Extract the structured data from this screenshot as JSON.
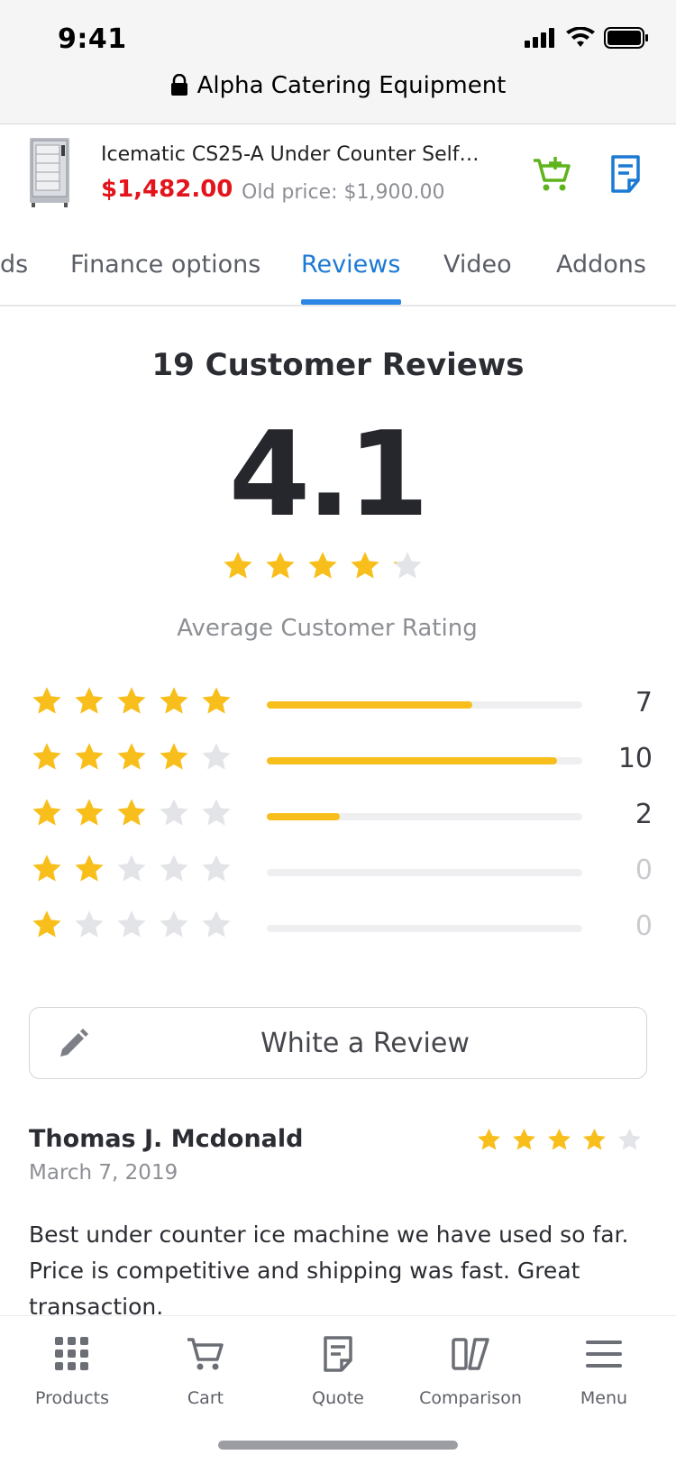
{
  "status_bar": {
    "time": "9:41"
  },
  "browser": {
    "url_title": "Alpha Catering Equipment"
  },
  "product": {
    "title": "Icematic CS25-A Under Counter Self…",
    "price": "$1,482.00",
    "old_price": "Old price: $1,900.00"
  },
  "tabs": [
    {
      "label": "ds"
    },
    {
      "label": "Finance options"
    },
    {
      "label": "Reviews",
      "active": true
    },
    {
      "label": "Video"
    },
    {
      "label": "Addons"
    }
  ],
  "summary": {
    "title": "19 Customer Reviews",
    "average": "4.1",
    "average_stars": 4.1,
    "label": "Average Customer Rating"
  },
  "distribution": [
    {
      "stars": 5,
      "count": "7",
      "fill": 0.65
    },
    {
      "stars": 4,
      "count": "10",
      "fill": 0.92
    },
    {
      "stars": 3,
      "count": "2",
      "fill": 0.23
    },
    {
      "stars": 2,
      "count": "0",
      "fill": 0
    },
    {
      "stars": 1,
      "count": "0",
      "fill": 0
    }
  ],
  "write_review": {
    "label": "White a Review"
  },
  "review": {
    "name": "Thomas J. Mcdonald",
    "date": "March 7, 2019",
    "rating": 4,
    "text": "Best under counter ice machine we have used so far. Price is competitive and shipping was fast. Great transaction."
  },
  "bottom_nav": [
    {
      "label": "Products",
      "icon": "grid-icon"
    },
    {
      "label": "Cart",
      "icon": "cart-icon"
    },
    {
      "label": "Quote",
      "icon": "quote-icon"
    },
    {
      "label": "Comparison",
      "icon": "comparison-icon"
    },
    {
      "label": "Menu",
      "icon": "menu-icon"
    }
  ],
  "colors": {
    "accent": "#1c7ad4",
    "price": "#e3141b",
    "star": "#f8bf1c",
    "star_empty": "#e3e4e7",
    "cart_green": "#5fb31c"
  }
}
